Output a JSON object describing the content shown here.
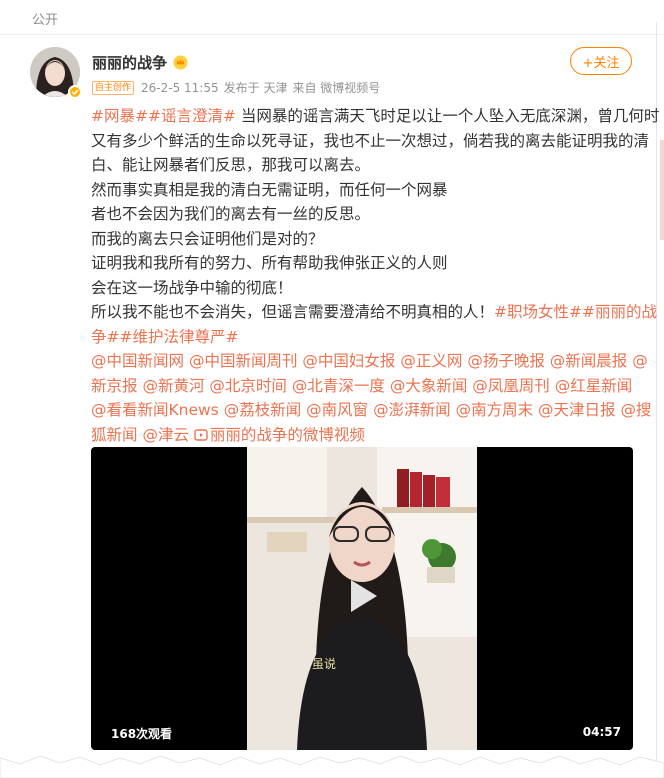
{
  "top_bar": {
    "visibility": "公开"
  },
  "author": {
    "name": "丽丽的战争",
    "creator_badge": "自主创作",
    "post_time": "26-2-5 11:55",
    "location": "发布于 天津",
    "source": "来自 微博视频号",
    "follow_label": "+关注"
  },
  "post": {
    "line1": {
      "tag1": "#网暴#",
      "tag2": "#谣言澄清#",
      "text": " 当网暴的谣言满天飞时足以让一个人坠入无底深渊，曾几何时"
    },
    "line2": "又有多少个鲜活的生命以死寻证，我也不止一次想过，倘若我的离去能证明我的清",
    "line3": "白、能让网暴者们反思，那我可以离去。",
    "line4": "然而事实真相是我的清白无需证明，而任何一个网暴",
    "line5": "者也不会因为我们的离去有一丝的反思。",
    "line6": "而我的离去只会证明他们是对的？",
    "line7": "证明我和我所有的努力、所有帮助我伸张正义的人则",
    "line8": "会在这一场战争中输的彻底！",
    "line9": {
      "text": "所以我不能也不会消失，但谣言需要澄清给不明真相的人！",
      "tag": "#职场女性#",
      "tag_split": "#丽丽的战"
    },
    "line10": {
      "tag_cont": "争#",
      "tag2": "#维护法律尊严#"
    },
    "mentions_line1": [
      "@中国新闻网",
      "@中国新闻周刊",
      "@中国妇女报",
      "@正义网",
      "@扬子晚报",
      "@新闻晨报",
      "@"
    ],
    "mentions_line2": [
      "新京报",
      "@新黄河",
      "@北京时间",
      "@北青深一度",
      "@大象新闻",
      "@凤凰周刊",
      "@红星新闻"
    ],
    "mentions_line3": [
      "@看看新闻Knews",
      "@荔枝新闻",
      "@南风窗",
      "@澎湃新闻",
      "@南方周末",
      "@天津日报",
      "@搜"
    ],
    "mentions_line4": {
      "cont": "狐新闻",
      "last": "@津云",
      "video_link": "丽丽的战争的微博视频"
    }
  },
  "video": {
    "views": "168次观看",
    "duration": "04:57",
    "caption": "虽说"
  },
  "colors": {
    "accent": "#ff8200",
    "link": "#eb7350"
  },
  "icons": {
    "level": "crown-icon",
    "verified": "verified-icon",
    "play": "play-icon",
    "video_link": "video-link-icon"
  }
}
